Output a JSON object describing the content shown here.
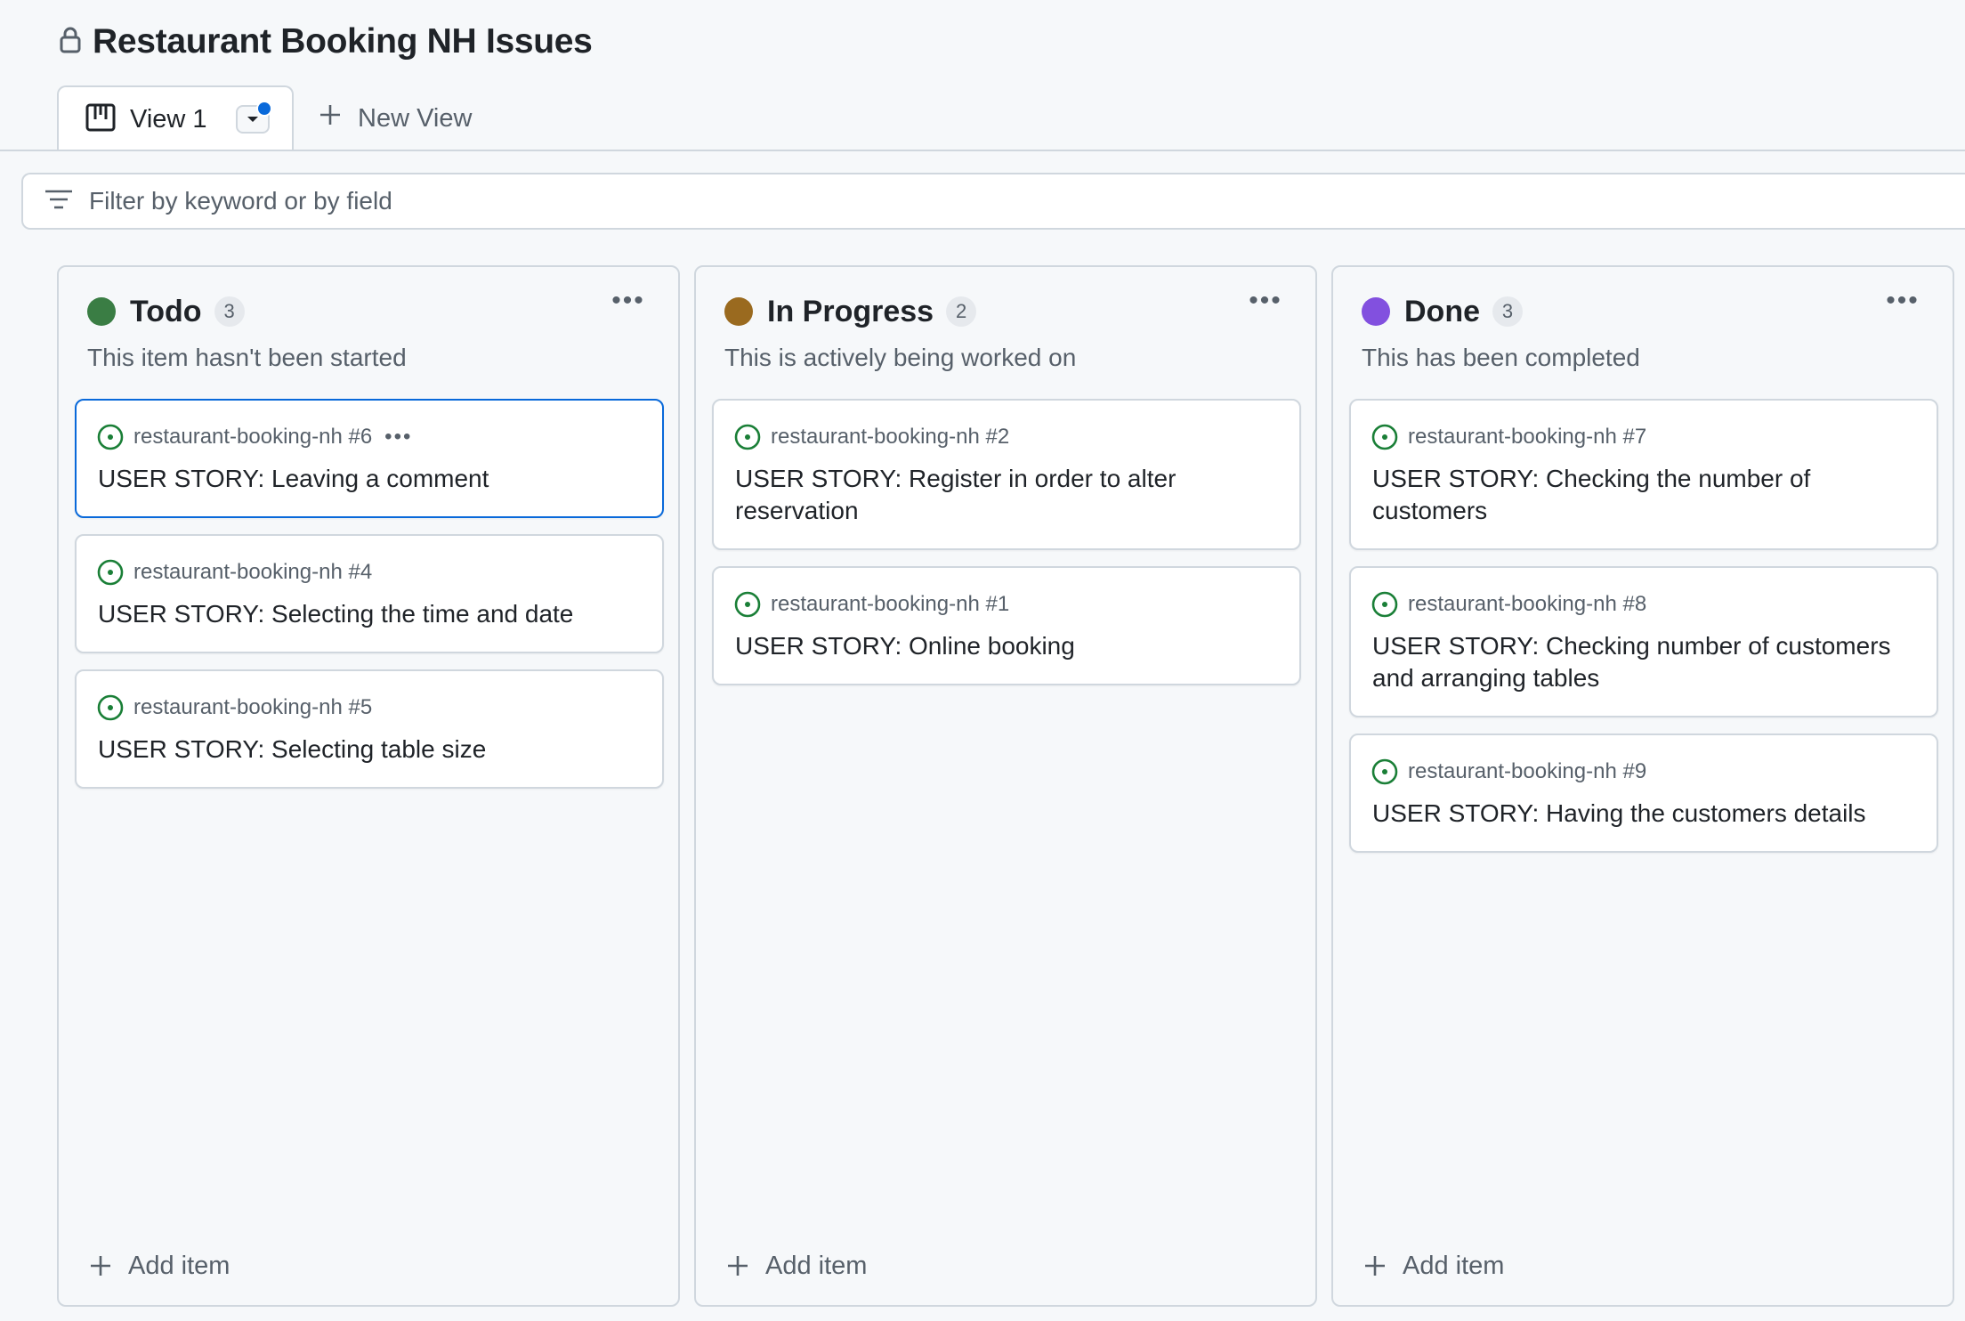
{
  "project": {
    "title": "Restaurant Booking NH Issues",
    "lock_icon": "lock-icon"
  },
  "tabs": {
    "active": {
      "label": "View 1",
      "icon": "board-icon"
    },
    "new_view_label": "New View"
  },
  "filter": {
    "placeholder": "Filter by keyword or by field",
    "value": ""
  },
  "columns": [
    {
      "name": "Todo",
      "count": "3",
      "color": "#3a7d44",
      "description": "This item hasn't been started",
      "add_label": "Add item",
      "cards": [
        {
          "ref": "restaurant-booking-nh #6",
          "title": "USER STORY: Leaving a comment",
          "selected": true
        },
        {
          "ref": "restaurant-booking-nh #4",
          "title": "USER STORY: Selecting the time and date"
        },
        {
          "ref": "restaurant-booking-nh #5",
          "title": "USER STORY: Selecting table size"
        }
      ]
    },
    {
      "name": "In Progress",
      "count": "2",
      "color": "#9a6a1f",
      "description": "This is actively being worked on",
      "add_label": "Add item",
      "cards": [
        {
          "ref": "restaurant-booking-nh #2",
          "title": "USER STORY: Register in order to alter reservation"
        },
        {
          "ref": "restaurant-booking-nh #1",
          "title": "USER STORY: Online booking"
        }
      ]
    },
    {
      "name": "Done",
      "count": "3",
      "color": "#8250df",
      "description": "This has been completed",
      "add_label": "Add item",
      "cards": [
        {
          "ref": "restaurant-booking-nh #7",
          "title": "USER STORY: Checking the number of customers"
        },
        {
          "ref": "restaurant-booking-nh #8",
          "title": "USER STORY: Checking number of customers and arranging tables"
        },
        {
          "ref": "restaurant-booking-nh #9",
          "title": "USER STORY: Having the customers details"
        }
      ]
    }
  ],
  "colors": {
    "open_issue": "#1a7f37",
    "selection": "#0969da",
    "border": "#d0d7de"
  }
}
